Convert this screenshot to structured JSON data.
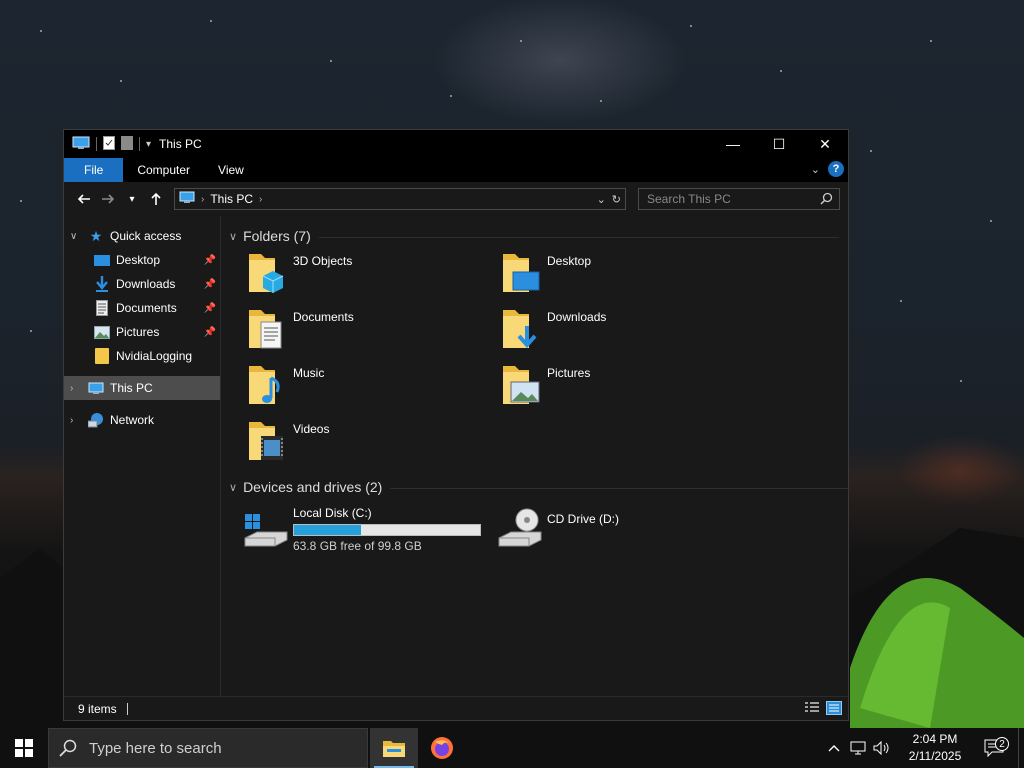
{
  "window": {
    "title": "This PC",
    "controls": {
      "minimize": "—",
      "maximize": "☐",
      "close": "✕"
    }
  },
  "ribbon": {
    "tabs": [
      {
        "label": "File"
      },
      {
        "label": "Computer"
      },
      {
        "label": "View"
      }
    ],
    "help": "?"
  },
  "address": {
    "crumbs": [
      "This PC"
    ],
    "search_placeholder": "Search This PC"
  },
  "sidebar": {
    "quick_access": "Quick access",
    "items": [
      {
        "label": "Desktop",
        "icon": "desktop-icon"
      },
      {
        "label": "Downloads",
        "icon": "downloads-icon"
      },
      {
        "label": "Documents",
        "icon": "documents-icon"
      },
      {
        "label": "Pictures",
        "icon": "pictures-icon"
      },
      {
        "label": "NvidiaLogging",
        "icon": "folder-icon"
      }
    ],
    "this_pc": "This PC",
    "network": "Network"
  },
  "content": {
    "folders_header": "Folders (7)",
    "folders": [
      {
        "label": "3D Objects"
      },
      {
        "label": "Desktop"
      },
      {
        "label": "Documents"
      },
      {
        "label": "Downloads"
      },
      {
        "label": "Music"
      },
      {
        "label": "Pictures"
      },
      {
        "label": "Videos"
      }
    ],
    "drives_header": "Devices and drives (2)",
    "drives": [
      {
        "label": "Local Disk (C:)",
        "free": "63.8 GB free of 99.8 GB",
        "used_fraction": 0.36
      },
      {
        "label": "CD Drive (D:)"
      }
    ]
  },
  "status": {
    "items": "9 items"
  },
  "taskbar": {
    "search_placeholder": "Type here to search",
    "time": "2:04 PM",
    "date": "2/11/2025",
    "notifications": "2"
  },
  "colors": {
    "accent": "#1a6fc0",
    "folder_yellow": "#f4c64a",
    "drive_bar": "#26a0da"
  }
}
